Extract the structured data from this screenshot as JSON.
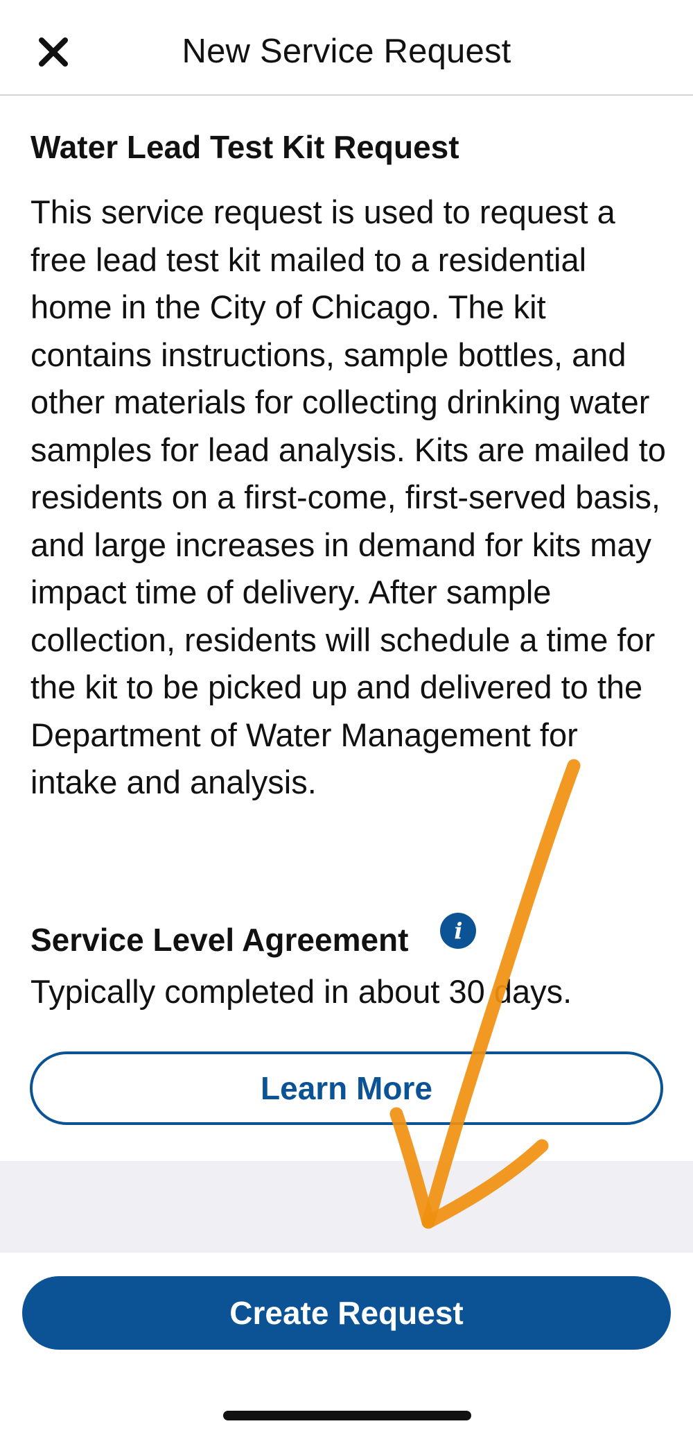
{
  "header": {
    "title": "New Service Request",
    "close_icon": "close-icon"
  },
  "request": {
    "title": "Water Lead Test Kit Request",
    "description": "This service request is used to request a free lead test kit mailed to a residential home in the City of Chicago. The kit contains instructions, sample bottles, and other materials for collecting drinking water samples for lead analysis. Kits are mailed to residents on a first-come, first-served basis, and large increases in demand for kits may impact time of delivery. After sample collection, residents will schedule a time for the kit to be picked up and delivered to the Department of Water Management for intake and analysis."
  },
  "sla": {
    "title": "Service Level Agreement",
    "info_icon": "info-icon",
    "text": "Typically completed in about 30 days."
  },
  "buttons": {
    "learn_more": "Learn More",
    "create_request": "Create Request"
  },
  "colors": {
    "primary": "#0b5394",
    "band": "#efeff4",
    "annotation": "#f0900f"
  }
}
